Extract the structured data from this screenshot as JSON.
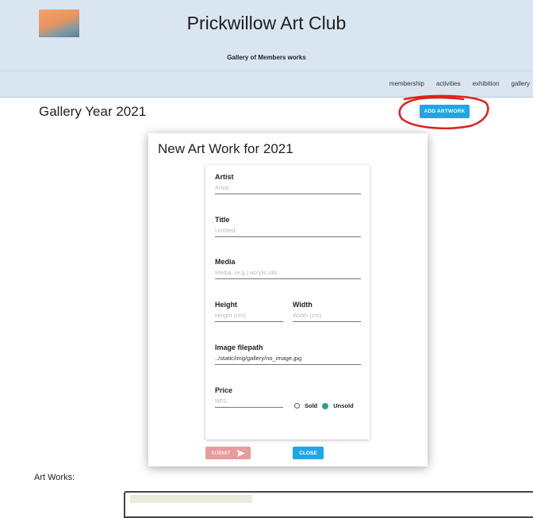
{
  "header": {
    "site_title": "Prickwillow Art Club",
    "subtitle": "Gallery of Members works",
    "logo_text": "Prickwillow Art Club"
  },
  "nav": {
    "items": [
      "membership",
      "activities",
      "exhibition",
      "gallery"
    ]
  },
  "gallery": {
    "title": "Gallery Year 2021",
    "add_button": "ADD ARTWORK"
  },
  "modal": {
    "title": "New Art Work for 2021",
    "fields": {
      "artist": {
        "label": "Artist",
        "placeholder": "Artist"
      },
      "title": {
        "label": "Title",
        "placeholder": "Untitled"
      },
      "media": {
        "label": "Media",
        "placeholder": "Media, (e.g.) acrylic,oils"
      },
      "height": {
        "label": "Height",
        "placeholder": "Height (cm)"
      },
      "width": {
        "label": "Width",
        "placeholder": "Width (cm)"
      },
      "image": {
        "label": "Image filepath",
        "value": "../static/img/gallery/no_image.jpg"
      },
      "price": {
        "label": "Price",
        "placeholder": "NFS"
      }
    },
    "radio": {
      "sold": "Sold",
      "unsold": "Unsold",
      "selected": "Unsold"
    },
    "submit": "SUBMIT",
    "close": "CLOSE"
  },
  "artworks": {
    "label": "Art Works:"
  },
  "colors": {
    "header_bg": "#d9e6f2",
    "accent_blue": "#1ea7e8",
    "submit_pink": "#e99a9c",
    "radio_green": "#2e9e8a",
    "annotation_red": "#e0201c"
  }
}
